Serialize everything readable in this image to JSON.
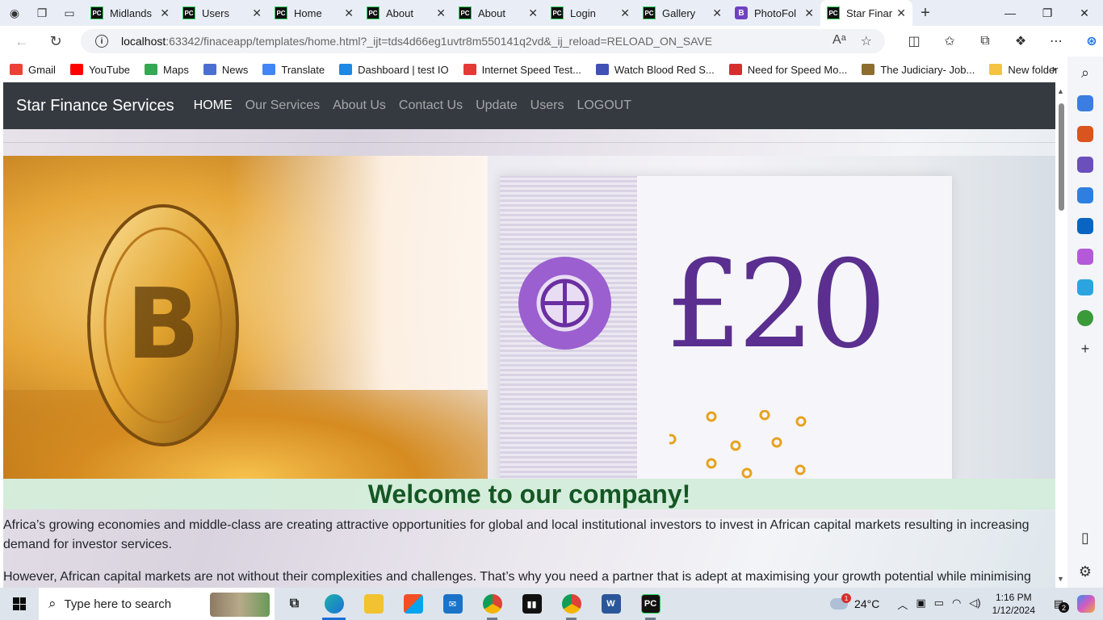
{
  "browser": {
    "tabs": [
      {
        "label": "Midlands",
        "favicon": "PC",
        "active": false
      },
      {
        "label": "Users",
        "favicon": "PC",
        "active": false
      },
      {
        "label": "Home",
        "favicon": "PC",
        "active": false
      },
      {
        "label": "About",
        "favicon": "PC",
        "active": false
      },
      {
        "label": "About",
        "favicon": "PC",
        "active": false
      },
      {
        "label": "Login",
        "favicon": "PC",
        "active": false
      },
      {
        "label": "Gallery",
        "favicon": "PC",
        "active": false
      },
      {
        "label": "PhotoFol",
        "favicon": "B",
        "active": false
      },
      {
        "label": "Star Finar",
        "favicon": "PC",
        "active": true
      }
    ],
    "url_host": "localhost",
    "url_path": ":63342/finaceapp/templates/home.html?_ijt=tds4d66eg1uvtr8m550141q2vd&_ij_reload=RELOAD_ON_SAVE",
    "bookmarks": [
      {
        "label": "Gmail",
        "color": "#ea4335"
      },
      {
        "label": "YouTube",
        "color": "#ff0000"
      },
      {
        "label": "Maps",
        "color": "#34a853"
      },
      {
        "label": "News",
        "color": "#4a6fd1"
      },
      {
        "label": "Translate",
        "color": "#4285f4"
      },
      {
        "label": "Dashboard | test IO",
        "color": "#1e88e5"
      },
      {
        "label": "Internet Speed Test...",
        "color": "#e53935"
      },
      {
        "label": "Watch Blood Red S...",
        "color": "#3f51b5"
      },
      {
        "label": "Need for Speed Mo...",
        "color": "#d32f2f"
      },
      {
        "label": "The Judiciary- Job...",
        "color": "#8d6e2f"
      },
      {
        "label": "New folder",
        "color": "#f5c242"
      }
    ]
  },
  "site": {
    "brand": "Star Finance Services",
    "nav": [
      {
        "label": "HOME",
        "active": true
      },
      {
        "label": "Our Services",
        "active": false
      },
      {
        "label": "About Us",
        "active": false
      },
      {
        "label": "Contact Us",
        "active": false
      },
      {
        "label": "Update",
        "active": false
      },
      {
        "label": "Users",
        "active": false
      },
      {
        "label": "LOGOUT",
        "active": false
      }
    ],
    "banner_note_value": "£20",
    "welcome_title": "Welcome to our company!",
    "paragraph_1": "Africa’s growing economies and middle-class are creating attractive opportunities for global and local institutional investors to invest in African capital markets resulting in increasing demand for investor services.",
    "paragraph_2": "However, African capital markets are not without their complexities and challenges. That’s why you need a partner that is adept at maximising your growth potential while minimising"
  },
  "taskbar": {
    "search_placeholder": "Type here to search",
    "weather_temp": "24°C",
    "weather_badge": "1",
    "time": "1:16 PM",
    "date": "1/12/2024",
    "notification_count": "2"
  },
  "colors": {
    "navbar": "#343a40",
    "welcome_band": "#d4edda",
    "welcome_text": "#155724",
    "accent": "#1a6fd6"
  }
}
